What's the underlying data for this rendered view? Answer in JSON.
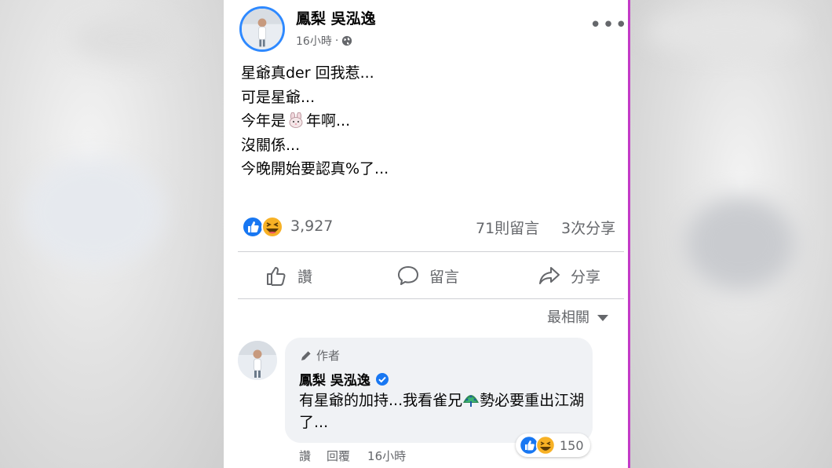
{
  "post": {
    "author": "鳳梨 吳泓逸",
    "time": "16小時",
    "time_separator": "·",
    "privacy_icon": "globe-icon",
    "more_label": "•••",
    "body": {
      "line1": "星爺真der 回我惹...",
      "line2": "可是星爺...",
      "line3_before": "今年是",
      "line3_emoji": "rabbit-emoji",
      "line3_after": "年啊...",
      "line4": "沒關係...",
      "line5": "今晚開始要認真%了..."
    }
  },
  "stats": {
    "reaction_icons": [
      "like-icon",
      "haha-icon"
    ],
    "reactions_count": "3,927",
    "comments_count": "71則留言",
    "shares_count": "3次分享"
  },
  "actions": {
    "like_label": "讚",
    "comment_label": "留言",
    "share_label": "分享"
  },
  "sort": {
    "label": "最相關"
  },
  "comment": {
    "author_tag": "作者",
    "name": "鳳梨 吳泓逸",
    "verified_icon": "verified-badge-icon",
    "text_before": "有星爺的加持...我看雀兄",
    "text_emoji": "peacock-emoji",
    "text_after": "勢必要重出江湖了...",
    "reactions_count": "150",
    "like_label": "讚",
    "reply_label": "回覆",
    "time": "16小時"
  },
  "colors": {
    "facebook_blue": "#1877f2",
    "haha_yellow": "#f7b125",
    "secondary_text": "#65676b",
    "bubble_bg": "#f0f2f5",
    "frame_edge": "#c33bc7"
  }
}
